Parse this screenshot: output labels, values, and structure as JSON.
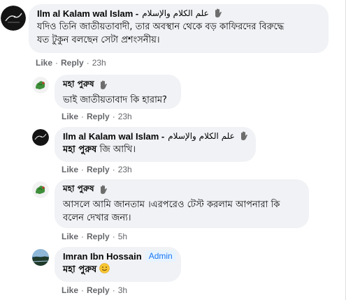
{
  "comments": [
    {
      "author": "Ilm al Kalam wal Islam - ",
      "author_arabic": "علم الكلام والإسلام",
      "author_icon": "waving-hand-icon",
      "avatar": "dark-logo-avatar",
      "text_line1": "যদিও তিনি জাতীয়তাবাদী, তার অবস্থান থেকে বড় কাফিরদের বিরুদ্ধে",
      "text_line2": "যত টুকুন বলছেন সেটা প্রশংসনীয়।",
      "like": "Like",
      "reply": "Reply",
      "time": "23h"
    },
    {
      "author": "মহা পুরুষ",
      "author_icon": "waving-hand-icon",
      "avatar": "green-map-avatar",
      "text": "ভাই জাতীয়তাবাদ কি হারাম?",
      "like": "Like",
      "reply": "Reply",
      "time": "23h"
    },
    {
      "author": "Ilm al Kalam wal Islam - ",
      "author_arabic": "علم الكلام والإسلام",
      "author_icon": "waving-hand-icon",
      "avatar": "dark-logo-avatar",
      "mention": "মহা পুরুষ",
      "text": " জি আখি।",
      "like": "Like",
      "reply": "Reply",
      "time": "23h"
    },
    {
      "author": "মহা পুরুষ",
      "author_icon": "waving-hand-icon",
      "avatar": "green-map-avatar",
      "text_line1": "আসলে আমি জানতাম ।এরপরেও টেস্ট করলাম আপনারা কি",
      "text_line2": "বলেন দেখার জন্য।",
      "like": "Like",
      "reply": "Reply",
      "time": "5h"
    },
    {
      "author": "Imran Ibn Hossain",
      "badge": "Admin",
      "avatar": "landscape-avatar",
      "mention": "মহা পুরুষ",
      "emoji": "smile-icon",
      "like": "Like",
      "reply": "Reply",
      "time": "3h"
    }
  ],
  "separator": "·",
  "colors": {
    "bubble": "#f0f2f5",
    "meta": "#65676b",
    "admin": "#1877f2"
  }
}
